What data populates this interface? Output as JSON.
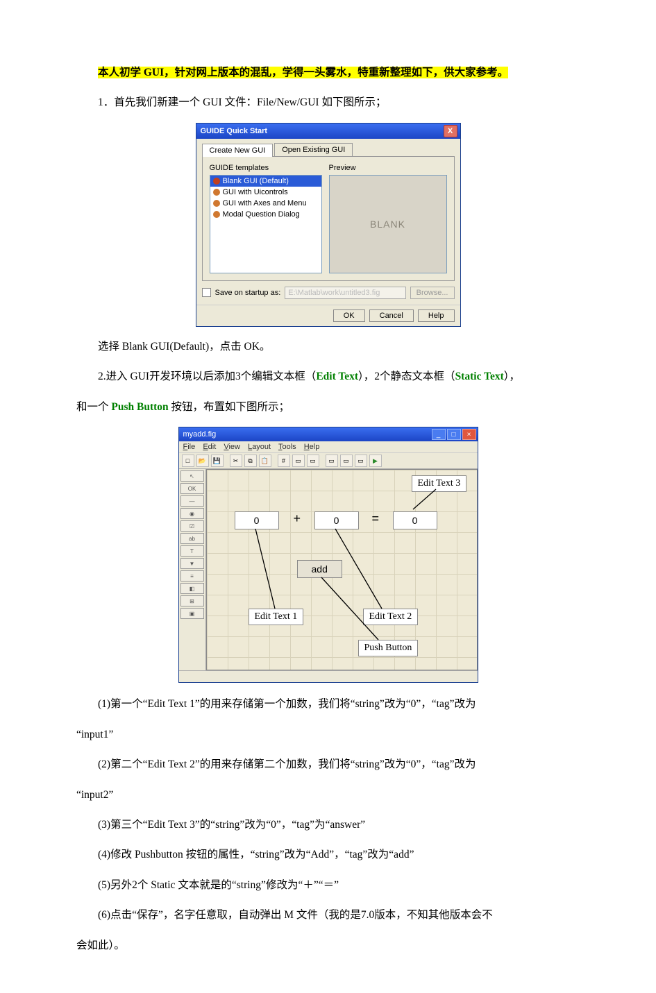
{
  "intro": "本人初学 GUI，针对网上版本的混乱，学得一头雾水，特重新整理如下，供大家参考。",
  "step1": "1．首先我们新建一个 GUI 文件：File/New/GUI  如下图所示；",
  "dialog1": {
    "title": "GUIDE Quick Start",
    "close": "X",
    "tab_new": "Create New GUI",
    "tab_open": "Open Existing GUI",
    "templates_label": "GUIDE templates",
    "items": {
      "t0": "Blank GUI (Default)",
      "t1": "GUI with Uicontrols",
      "t2": "GUI with Axes and Menu",
      "t3": "Modal Question Dialog"
    },
    "preview_label": "Preview",
    "preview_text": "BLANK",
    "save_label": "Save on startup as:",
    "save_path": "E:\\Matlab\\work\\untitled3.fig",
    "browse": "Browse...",
    "ok": "OK",
    "cancel": "Cancel",
    "help": "Help"
  },
  "afterDialog": "选择 Blank GUI(Default)，点击 OK。",
  "step2_a": "2.进入 GUI开发环境以后添加3个编辑文本框（",
  "step2_edit": "Edit Text",
  "step2_b": "），2个静态文本框（",
  "step2_static": "Static Text",
  "step2_c": "），",
  "step2_line2_a": "和一个 ",
  "step2_push": "Push Button",
  "step2_line2_b": " 按钮，布置如下图所示；",
  "editor": {
    "title": "myadd.fig",
    "menus": {
      "m0": "File",
      "m1": "Edit",
      "m2": "View",
      "m3": "Layout",
      "m4": "Tools",
      "m5": "Help"
    },
    "field1": "0",
    "field2": "0",
    "field3": "0",
    "plus": "+",
    "equals": "=",
    "addBtn": "add",
    "callouts": {
      "et1": "Edit Text 1",
      "et2": "Edit Text 2",
      "et3": "Edit Text 3",
      "pb": "Push Button"
    }
  },
  "items": {
    "i1": "(1)第一个“Edit Text 1”的用来存储第一个加数，我们将“string”改为“0”，“tag”改为",
    "i1b": "“input1”",
    "i2": "(2)第二个“Edit Text 2”的用来存储第二个加数，我们将“string”改为“0”，“tag”改为",
    "i2b": "“input2”",
    "i3": "(3)第三个“Edit Text 3”的“string”改为“0”，“tag”为“answer”",
    "i4": "(4)修改 Pushbutton 按钮的属性，“string”改为“Add”，“tag”改为“add”",
    "i5": "(5)另外2个 Static 文本就是的“string”修改为“＋”“＝”",
    "i6": "(6)点击“保存”，名字任意取，自动弹出 M 文件（我的是7.0版本，不知其他版本会不",
    "i6b": "会如此）。"
  }
}
